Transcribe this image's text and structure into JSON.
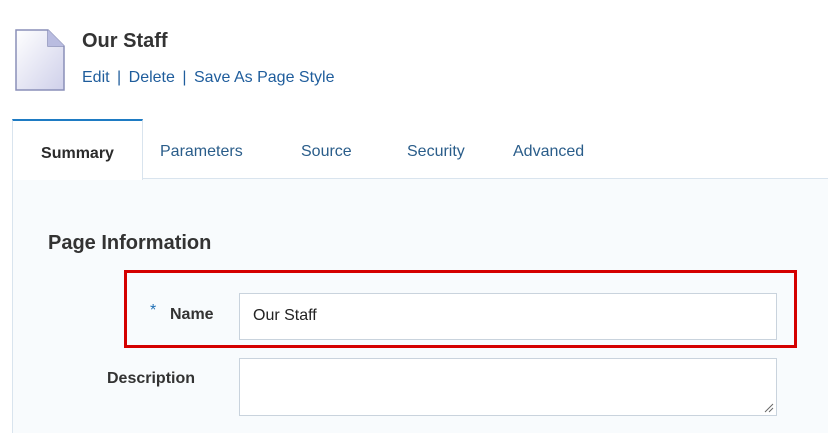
{
  "header": {
    "title": "Our Staff",
    "actions": {
      "edit": "Edit",
      "delete": "Delete",
      "save_as_page_style": "Save As Page Style",
      "separator": "|"
    }
  },
  "tabs": [
    {
      "label": "Summary",
      "active": true
    },
    {
      "label": "Parameters",
      "active": false
    },
    {
      "label": "Source",
      "active": false
    },
    {
      "label": "Security",
      "active": false
    },
    {
      "label": "Advanced",
      "active": false
    }
  ],
  "section": {
    "title": "Page Information"
  },
  "form": {
    "name": {
      "required_marker": "*",
      "label": "Name",
      "value": "Our Staff"
    },
    "description": {
      "label": "Description",
      "value": ""
    }
  },
  "colors": {
    "link": "#1f5d9c",
    "active_tab_accent": "#1e7bc3",
    "highlight_box": "#d40000",
    "required_marker": "#1f6fb5"
  },
  "icons": {
    "page": "page-document-icon",
    "resize": "resize-grip-icon"
  }
}
